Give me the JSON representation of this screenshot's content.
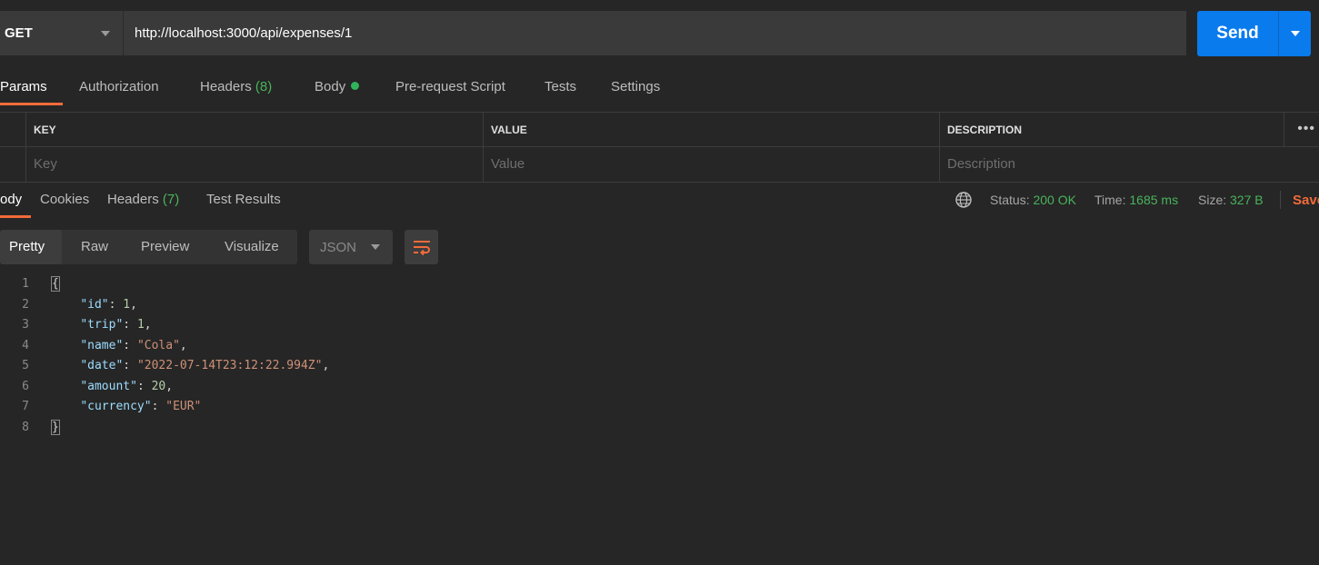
{
  "request": {
    "method": "GET",
    "url": "http://localhost:3000/api/expenses/1",
    "send_label": "Send"
  },
  "request_tabs": [
    {
      "label": "Params",
      "count": ""
    },
    {
      "label": "Authorization",
      "count": ""
    },
    {
      "label": "Headers",
      "count": "(8)"
    },
    {
      "label": "Body",
      "count": ""
    },
    {
      "label": "Pre-request Script",
      "count": ""
    },
    {
      "label": "Tests",
      "count": ""
    },
    {
      "label": "Settings",
      "count": ""
    }
  ],
  "params_table": {
    "headers": [
      "KEY",
      "VALUE",
      "DESCRIPTION"
    ],
    "placeholders": [
      "Key",
      "Value",
      "Description"
    ],
    "more": "•••"
  },
  "response_tabs": [
    {
      "label": "Body",
      "visible_label": "ody",
      "count": ""
    },
    {
      "label": "Cookies",
      "count": ""
    },
    {
      "label": "Headers",
      "count": "(7)"
    },
    {
      "label": "Test Results",
      "count": ""
    }
  ],
  "response_meta": {
    "status_label": "Status:",
    "status_value": "200 OK",
    "time_label": "Time:",
    "time_value": "1685 ms",
    "size_label": "Size:",
    "size_value": "327 B",
    "save_label": "Save"
  },
  "format_tabs": [
    "Pretty",
    "Raw",
    "Preview",
    "Visualize"
  ],
  "format_select": "JSON",
  "code_lines": [
    {
      "n": "1",
      "parts": [
        [
          "p",
          "{"
        ]
      ]
    },
    {
      "n": "2",
      "parts": [
        [
          "p",
          "    "
        ],
        [
          "k",
          "\"id\""
        ],
        [
          "p",
          ": "
        ],
        [
          "n",
          "1"
        ],
        [
          "p",
          ","
        ]
      ]
    },
    {
      "n": "3",
      "parts": [
        [
          "p",
          "    "
        ],
        [
          "k",
          "\"trip\""
        ],
        [
          "p",
          ": "
        ],
        [
          "n",
          "1"
        ],
        [
          "p",
          ","
        ]
      ]
    },
    {
      "n": "4",
      "parts": [
        [
          "p",
          "    "
        ],
        [
          "k",
          "\"name\""
        ],
        [
          "p",
          ": "
        ],
        [
          "s",
          "\"Cola\""
        ],
        [
          "p",
          ","
        ]
      ]
    },
    {
      "n": "5",
      "parts": [
        [
          "p",
          "    "
        ],
        [
          "k",
          "\"date\""
        ],
        [
          "p",
          ": "
        ],
        [
          "s",
          "\"2022-07-14T23:12:22.994Z\""
        ],
        [
          "p",
          ","
        ]
      ]
    },
    {
      "n": "6",
      "parts": [
        [
          "p",
          "    "
        ],
        [
          "k",
          "\"amount\""
        ],
        [
          "p",
          ": "
        ],
        [
          "n",
          "20"
        ],
        [
          "p",
          ","
        ]
      ]
    },
    {
      "n": "7",
      "parts": [
        [
          "p",
          "    "
        ],
        [
          "k",
          "\"currency\""
        ],
        [
          "p",
          ": "
        ],
        [
          "s",
          "\"EUR\""
        ]
      ]
    },
    {
      "n": "8",
      "parts": [
        [
          "p",
          "}"
        ]
      ]
    }
  ],
  "colors": {
    "accent": "#f26b3a",
    "primary": "#097bed",
    "success": "#49b35a"
  },
  "icons": {
    "method_caret": "chevron-down-icon",
    "send_caret": "chevron-down-icon",
    "globe": "globe-icon",
    "wrap": "wrap-lines-icon"
  }
}
